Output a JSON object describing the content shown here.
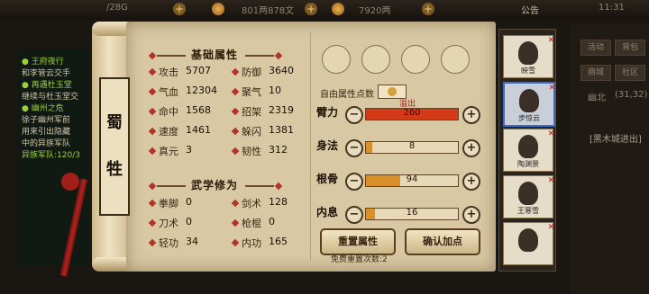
{
  "topbar": {
    "coins": "/28G",
    "copper": "801两878文",
    "silver": "7920两",
    "notice": "公告",
    "time": "11:31"
  },
  "quest": {
    "lines": [
      {
        "text": "● 王府夜行",
        "color": "#9bd23a"
      },
      {
        "text": "和李管云交手",
        "color": "#cfc6a8"
      },
      {
        "text": "● 再遇杜玉堂",
        "color": "#9bd23a"
      },
      {
        "text": "继续与杜玉堂交",
        "color": "#cfc6a8"
      },
      {
        "text": "● 幽州之危",
        "color": "#9bd23a"
      },
      {
        "text": "徐子幽州军前",
        "color": "#cfc6a8"
      },
      {
        "text": "用来引出隐藏",
        "color": "#cfc6a8"
      },
      {
        "text": "中的异族军队",
        "color": "#cfc6a8"
      },
      {
        "text": "异族军队:120/3",
        "color": "#9bd23a"
      }
    ]
  },
  "rightbg": {
    "buttons": [
      "活动",
      "背包",
      "商城",
      "社区"
    ],
    "region": "幽北",
    "coords": "(31,32)",
    "chat": "[黑木城进出]"
  },
  "sect": {
    "name_chars": [
      "蜀",
      "牲"
    ]
  },
  "basic": {
    "title": "基础属性",
    "stats": [
      {
        "label": "攻击",
        "value": "5707"
      },
      {
        "label": "防御",
        "value": "3640"
      },
      {
        "label": "气血",
        "value": "12304"
      },
      {
        "label": "聚气",
        "value": "10"
      },
      {
        "label": "命中",
        "value": "1568"
      },
      {
        "label": "招架",
        "value": "2319"
      },
      {
        "label": "速度",
        "value": "1461"
      },
      {
        "label": "躲闪",
        "value": "1381"
      },
      {
        "label": "真元",
        "value": "3"
      },
      {
        "label": "韧性",
        "value": "312"
      }
    ]
  },
  "martial": {
    "title": "武学修为",
    "stats": [
      {
        "label": "拳脚",
        "value": "0"
      },
      {
        "label": "剑术",
        "value": "128"
      },
      {
        "label": "刀术",
        "value": "0"
      },
      {
        "label": "枪棍",
        "value": "0"
      },
      {
        "label": "轻功",
        "value": "34"
      },
      {
        "label": "内功",
        "value": "165"
      }
    ]
  },
  "free_points": {
    "label": "自由属性点数"
  },
  "attributes": [
    {
      "label": "臂力",
      "value": "260",
      "overflow": "溢出",
      "fill": 1.0,
      "color": "#d23a18"
    },
    {
      "label": "身法",
      "value": "8",
      "fill": 0.07,
      "color": "#d9902a"
    },
    {
      "label": "根骨",
      "value": "94",
      "fill": 0.37,
      "color": "#d9902a"
    },
    {
      "label": "内息",
      "value": "16",
      "fill": 0.1,
      "color": "#d9902a"
    }
  ],
  "buttons": {
    "reset": "重置属性",
    "confirm": "确认加点",
    "reset_hint": "免费重置次数:2"
  },
  "roster": [
    {
      "name": "映雪",
      "selected": false
    },
    {
      "name": "步惊云",
      "selected": true
    },
    {
      "name": "陶渊景",
      "selected": false
    },
    {
      "name": "王寒雪",
      "selected": false
    },
    {
      "name": "",
      "selected": false
    }
  ],
  "colors": {
    "scroll": "#d8c8a4",
    "accent_red": "#b3322a"
  }
}
